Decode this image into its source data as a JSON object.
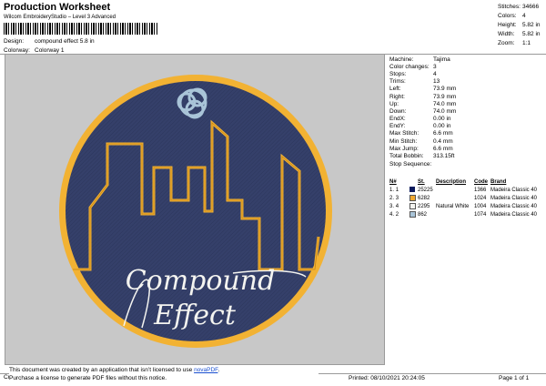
{
  "header": {
    "title": "Production Worksheet",
    "subtitle": "Wilcom EmbroideryStudio – Level 3 Advanced"
  },
  "design_info": [
    {
      "label": "Design:",
      "value": "compound effect 5.8 in"
    },
    {
      "label": "Colorway:",
      "value": "Colorway 1"
    }
  ],
  "stats": [
    {
      "label": "Stitches:",
      "value": "34666"
    },
    {
      "label": "Colors:",
      "value": "4"
    },
    {
      "label": "Height:",
      "value": "5.82 in"
    },
    {
      "label": "Width:",
      "value": "5.82 in"
    },
    {
      "label": "Zoom:",
      "value": "1:1"
    }
  ],
  "machine": [
    {
      "label": "Machine:",
      "value": "Tajima"
    },
    {
      "label": "Color changes:",
      "value": "3"
    },
    {
      "label": "Stops:",
      "value": "4"
    },
    {
      "label": "Trims:",
      "value": "13"
    },
    {
      "label": "Left:",
      "value": "73.9 mm"
    },
    {
      "label": "Right:",
      "value": "73.9 mm"
    },
    {
      "label": "Up:",
      "value": "74.0 mm"
    },
    {
      "label": "Down:",
      "value": "74.0 mm"
    },
    {
      "label": "EndX:",
      "value": "0.00 in"
    },
    {
      "label": "EndY:",
      "value": "0.00 in"
    },
    {
      "label": "Max Stitch:",
      "value": "6.6 mm"
    },
    {
      "label": "Min Stitch:",
      "value": "0.4 mm"
    },
    {
      "label": "Max Jump:",
      "value": "6.6 mm"
    },
    {
      "label": "Total Bobbin:",
      "value": "313.15ft"
    }
  ],
  "stop_sequence": {
    "label": "Stop Sequence:",
    "columns": [
      "N#",
      "St.",
      "Description",
      "Code",
      "Brand"
    ],
    "rows": [
      {
        "n": "1.",
        "k": "1",
        "color": "#1f2d5c",
        "st": "25225",
        "desc": "",
        "code": "1366",
        "brand": "Madeira Classic 40"
      },
      {
        "n": "2.",
        "k": "3",
        "color": "#f0a830",
        "st": "6282",
        "desc": "",
        "code": "1024",
        "brand": "Madeira Classic 40"
      },
      {
        "n": "3.",
        "k": "4",
        "color": "#f4f4f0",
        "st": "2295",
        "desc": "Natural White",
        "code": "1004",
        "brand": "Madeira Classic 40"
      },
      {
        "n": "4.",
        "k": "2",
        "color": "#a9c4d8",
        "st": "862",
        "desc": "",
        "code": "1074",
        "brand": "Madeira Classic 40"
      }
    ]
  },
  "design_art": {
    "text_line1": "Compound",
    "text_line2": "Effect",
    "colors": {
      "fill": "#35406a",
      "gold": "#f2b233",
      "white": "#f4f4f0",
      "knot": "#a9c4d8"
    }
  },
  "notice": {
    "line1_pre": "This document was created by an application that isn’t licensed to use ",
    "link": "novaPDF",
    "line1_post": ".",
    "line2": "Purchase a license to generate PDF files without this notice."
  },
  "footer": {
    "cr": "Cr",
    "printed": "Printed: 08/10/2021 20:24:05",
    "page": "Page 1 of 1"
  }
}
